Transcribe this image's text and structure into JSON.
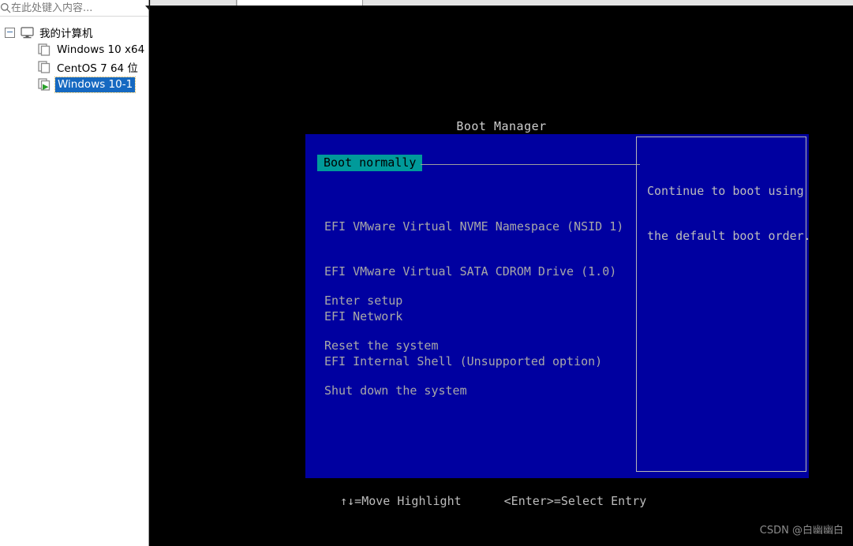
{
  "window": {
    "tabs": [
      {
        "label": "",
        "active": false,
        "width": 110
      },
      {
        "label": "",
        "active": true,
        "width": 160
      },
      {
        "label": "",
        "active": false,
        "width": 0
      }
    ]
  },
  "sidebar": {
    "search": {
      "placeholder": "在此处键入内容...",
      "value": "",
      "icon": "search-icon",
      "dropdown_icon": "chevron-down-icon"
    },
    "tree": {
      "root": {
        "label": "我的计算机",
        "icon": "computer-icon",
        "expander": "collapse-minus-icon",
        "expanded": true
      },
      "items": [
        {
          "label": "Windows 10 x64",
          "icon": "vm-icon",
          "selected": false,
          "running": false
        },
        {
          "label": "CentOS 7 64 位",
          "icon": "vm-icon",
          "selected": false,
          "running": false
        },
        {
          "label": "Windows 10-1",
          "icon": "vm-running-icon",
          "selected": true,
          "running": true
        }
      ]
    }
  },
  "console": {
    "title": "Boot Manager",
    "menu": {
      "highlighted": "Boot normally",
      "efi_entries": [
        "EFI VMware Virtual NVME Namespace (NSID 1)",
        "EFI VMware Virtual SATA CDROM Drive (1.0)",
        "EFI Network",
        "EFI Internal Shell (Unsupported option)"
      ],
      "actions": [
        "Enter setup",
        "Reset the system",
        "Shut down the system"
      ]
    },
    "help": {
      "line1": "Continue to boot using",
      "line2": "the default boot order."
    },
    "footer": {
      "move": "↑↓=Move Highlight",
      "select": "<Enter>=Select Entry"
    }
  },
  "watermark": {
    "text": "CSDN @白幽幽白"
  },
  "colors": {
    "bios_blue": "#0000a0",
    "highlight_teal": "#009a9a",
    "menu_text": "#a8a8a8",
    "selection_blue": "#1669c1",
    "console_black": "#000000"
  }
}
